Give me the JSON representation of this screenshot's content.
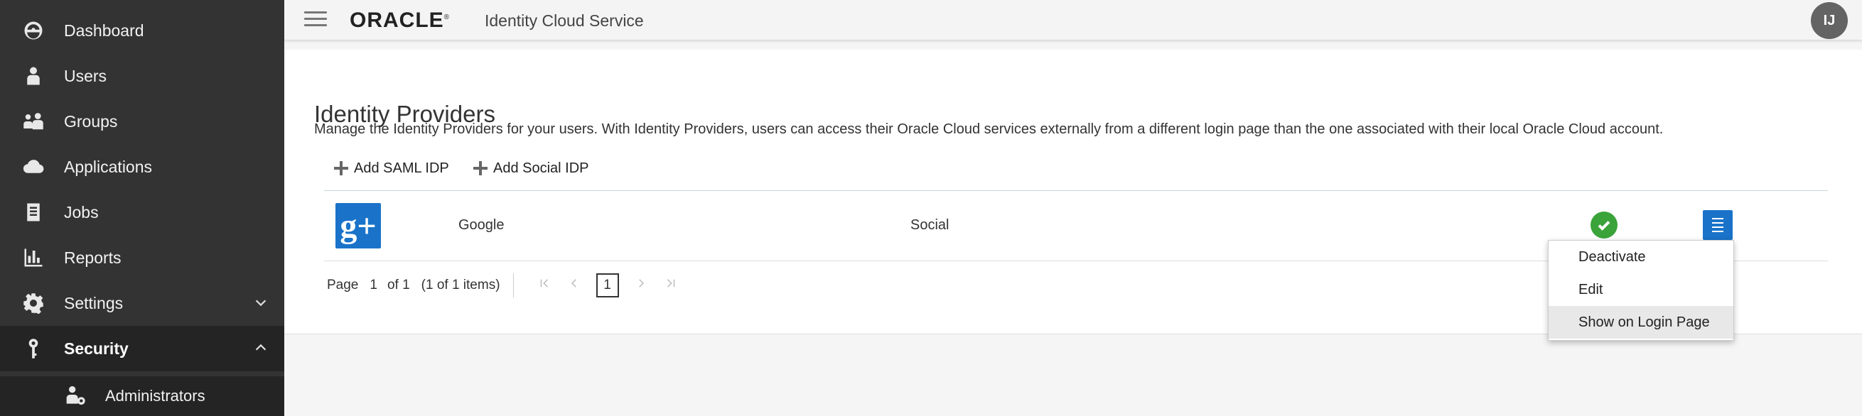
{
  "sidebar": {
    "items": [
      {
        "label": "Dashboard",
        "icon": "dashboard-icon"
      },
      {
        "label": "Users",
        "icon": "user-icon"
      },
      {
        "label": "Groups",
        "icon": "groups-icon"
      },
      {
        "label": "Applications",
        "icon": "cloud-icon"
      },
      {
        "label": "Jobs",
        "icon": "jobs-icon"
      },
      {
        "label": "Reports",
        "icon": "reports-icon"
      },
      {
        "label": "Settings",
        "icon": "gear-icon",
        "expanded": false
      },
      {
        "label": "Security",
        "icon": "key-icon",
        "expanded": true,
        "active": true
      }
    ],
    "sub_items": [
      {
        "label": "Administrators",
        "icon": "administrators-icon"
      }
    ]
  },
  "header": {
    "logo": "ORACLE",
    "logo_mark": "®",
    "app_title": "Identity Cloud Service",
    "avatar_initials": "IJ"
  },
  "main": {
    "title": "Identity Providers",
    "description": "Manage the Identity Providers for your users. With Identity Providers, users can access their Oracle Cloud services externally from a different login page than the one associated with their local Oracle Cloud account.",
    "toolbar": {
      "add_saml_label": "Add SAML IDP",
      "add_social_label": "Add Social IDP"
    },
    "rows": [
      {
        "logo_text": "g+",
        "name": "Google",
        "type": "Social",
        "status": "active"
      }
    ],
    "pager": {
      "page_label": "Page",
      "page": "1",
      "of_label": "of 1",
      "items_label": "(1 of 1 items)",
      "current_page": "1"
    }
  },
  "dropdown": {
    "items": [
      "Deactivate",
      "Edit",
      "Show on Login Page"
    ]
  },
  "colors": {
    "sidebar_bg": "#333333",
    "accent_blue": "#1a73c9",
    "success_green": "#3aa33a"
  }
}
